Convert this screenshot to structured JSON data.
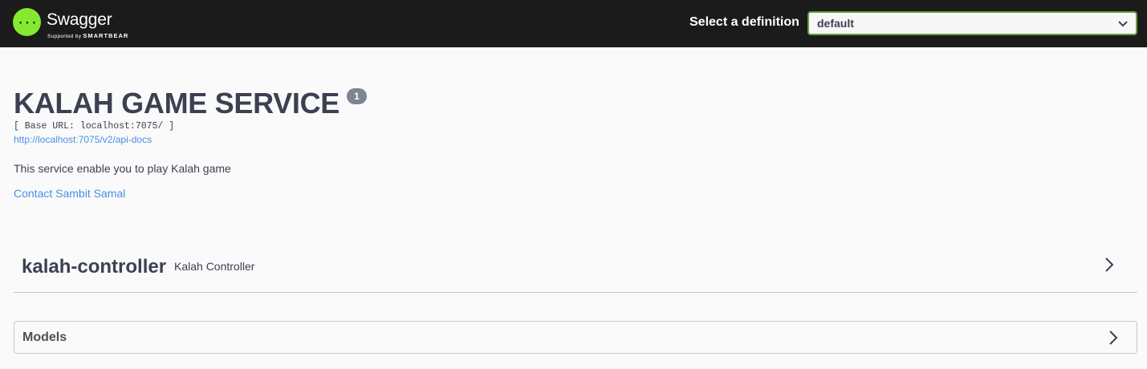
{
  "topbar": {
    "logo_title": "Swagger",
    "logo_sub_prefix": "Supported by",
    "logo_sub_brand": "SMARTBEAR",
    "definition_label": "Select a definition",
    "definition_selected": "default",
    "logo_color": "#85ea2d",
    "select_border_color": "#62a03f"
  },
  "info": {
    "title": "KALAH GAME SERVICE",
    "version": "1",
    "base_url": "[ Base URL: localhost:7075/ ]",
    "api_docs_link": "http://localhost:7075/v2/api-docs",
    "description": "This service enable you to play Kalah game",
    "contact": "Contact Sambit Samal",
    "link_color": "#4990e2"
  },
  "tags": [
    {
      "name": "kalah-controller",
      "description": "Kalah Controller",
      "icon": "chevron-right-icon"
    }
  ],
  "models": {
    "title": "Models",
    "icon": "chevron-right-icon"
  }
}
